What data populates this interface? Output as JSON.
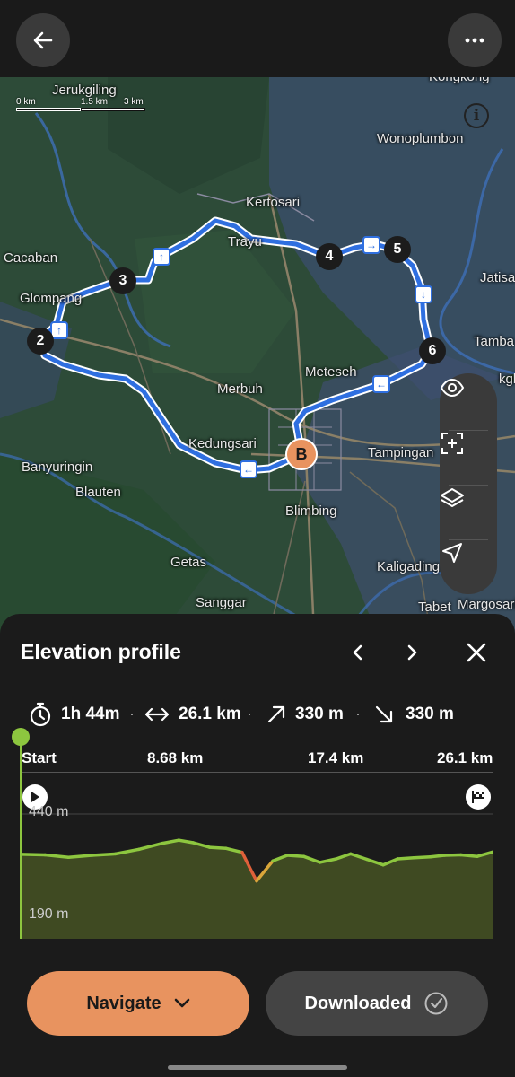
{
  "map": {
    "scale": {
      "zero": "0 km",
      "mid": "1.5 km",
      "max": "3 km"
    },
    "places": [
      {
        "id": "jerukgiling",
        "name": "Jerukgiling"
      },
      {
        "id": "kongkong",
        "name": "Kongkong"
      },
      {
        "id": "wonoplumbon",
        "name": "Wonoplumbon"
      },
      {
        "id": "kertosari",
        "name": "Kertosari"
      },
      {
        "id": "cacaban",
        "name": "Cacaban"
      },
      {
        "id": "trayu",
        "name": "Trayu"
      },
      {
        "id": "jatisa",
        "name": "Jatisa"
      },
      {
        "id": "glompang",
        "name": "Glompang"
      },
      {
        "id": "tamba",
        "name": "Tamba"
      },
      {
        "id": "meteseh",
        "name": "Meteseh"
      },
      {
        "id": "merbuh",
        "name": "Merbuh"
      },
      {
        "id": "kedungsari",
        "name": "Kedungsari"
      },
      {
        "id": "tampingan",
        "name": "Tampingan"
      },
      {
        "id": "banyuringin",
        "name": "Banyuringin"
      },
      {
        "id": "blauten",
        "name": "Blauten"
      },
      {
        "id": "blimbing",
        "name": "Blimbing"
      },
      {
        "id": "getas",
        "name": "Getas"
      },
      {
        "id": "kaligading",
        "name": "Kaligading"
      },
      {
        "id": "sanggar",
        "name": "Sanggar"
      },
      {
        "id": "tabet",
        "name": "Tabet"
      },
      {
        "id": "margosari",
        "name": "Margosari"
      },
      {
        "id": "kgki",
        "name": "kgki"
      }
    ],
    "waypoints": [
      "2",
      "3",
      "4",
      "5",
      "6"
    ],
    "end_marker": "B",
    "info_label": "i",
    "route_color": "#2f6fe0"
  },
  "panel": {
    "title": "Elevation profile",
    "stats": {
      "duration": "1h 44m",
      "distance": "26.1 km",
      "ascent": "330 m",
      "descent": "330 m",
      "separator": "·"
    },
    "distance_axis": [
      "Start",
      "8.68 km",
      "17.4 km",
      "26.1 km"
    ],
    "elevation_axis": {
      "max_label": "440 m",
      "min_label": "190 m"
    },
    "navigate_label": "Navigate",
    "downloaded_label": "Downloaded"
  },
  "chart_data": {
    "type": "area",
    "x": [
      0,
      1.3,
      2.6,
      3.9,
      5.2,
      6.5,
      7.8,
      8.7,
      9.5,
      10.4,
      11.3,
      12.2,
      12.6,
      13.0,
      13.9,
      14.7,
      15.6,
      16.5,
      17.4,
      18.2,
      19.1,
      20.0,
      20.8,
      21.7,
      22.6,
      23.4,
      24.3,
      25.2,
      26.1
    ],
    "y": [
      358,
      357,
      352,
      356,
      359,
      368,
      380,
      386,
      381,
      372,
      370,
      362,
      333,
      305,
      345,
      356,
      354,
      342,
      349,
      359,
      348,
      337,
      349,
      351,
      353,
      356,
      357,
      354,
      363
    ],
    "xlim": [
      0,
      26.1
    ],
    "ylim": [
      190,
      440
    ],
    "x_ticks": [
      "Start",
      "8.68 km",
      "17.4 km",
      "26.1 km"
    ],
    "y_ticks": [
      "440 m",
      "190 m"
    ],
    "line_color": "#8dc63f",
    "fill_color": "#3f4a22"
  }
}
